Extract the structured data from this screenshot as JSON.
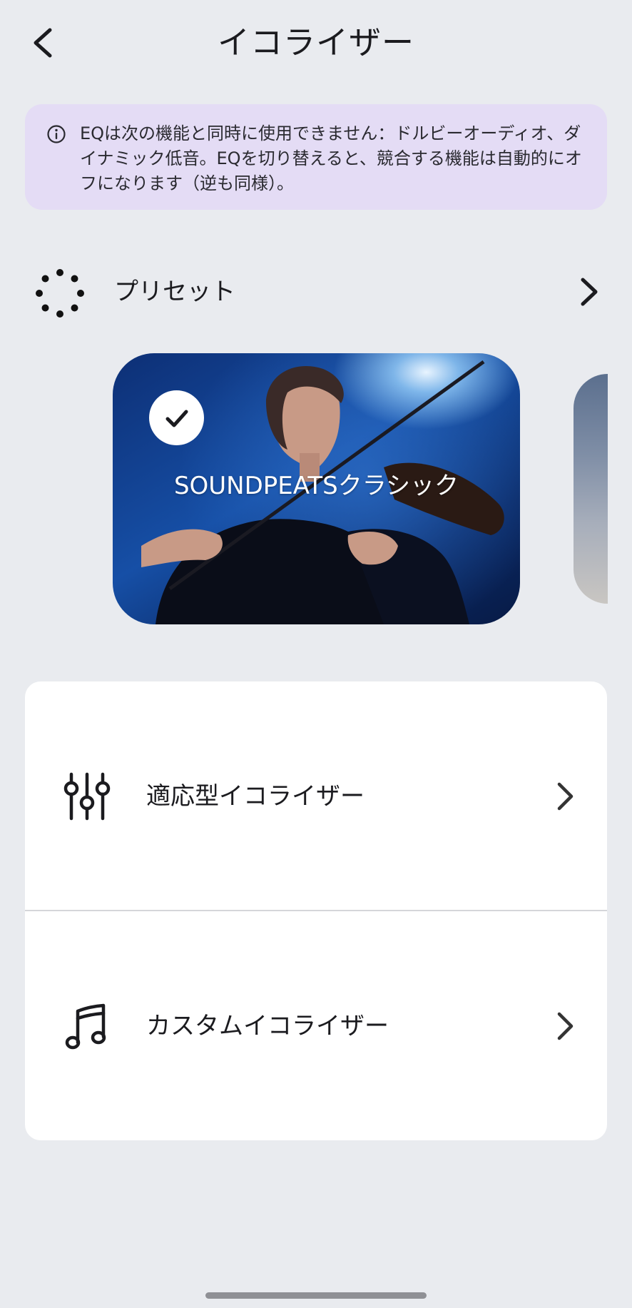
{
  "header": {
    "title": "イコライザー",
    "back_icon": "chevron-left-icon"
  },
  "notice": {
    "icon": "info-icon",
    "text": "EQは次の機能と同時に使用できません：ドルビーオーディオ、ダイナミック低音。EQを切り替えると、競合する機能は自動的にオフになります（逆も同様）。"
  },
  "preset": {
    "icon": "preset-dots-icon",
    "label": "プリセット",
    "chevron_icon": "chevron-right-icon",
    "cards": [
      {
        "label": "SOUNDPEATSクラシック",
        "selected": true,
        "image": "violinist-photo"
      }
    ]
  },
  "menu": {
    "items": [
      {
        "label": "適応型イコライザー",
        "icon": "equalizer-sliders-icon"
      },
      {
        "label": "カスタムイコライザー",
        "icon": "music-note-icon"
      }
    ]
  },
  "colors": {
    "background": "#e9ebef",
    "notice_background": "#e4dcf5",
    "card_background": "#ffffff",
    "text": "#1b1b1f"
  }
}
